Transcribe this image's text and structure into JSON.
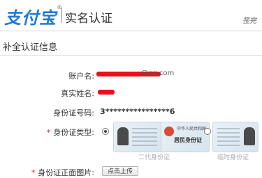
{
  "header": {
    "logo_text": "支付宝",
    "logo_reg": "®",
    "page_title": "实名认证",
    "exit_link": "签完"
  },
  "section": {
    "title": "补全认证信息"
  },
  "form": {
    "account_label": "账户名:",
    "account_value_suffix": "@qq.com",
    "realname_label": "真实姓名:",
    "id_number_label": "身份证号码:",
    "id_number_value": "3****************6",
    "id_type_label": "身份证类型:",
    "id_type_required": "*",
    "id_type_options": [
      {
        "caption": "二代身份证",
        "selected": true
      },
      {
        "caption": "临时身份证",
        "selected": false
      }
    ],
    "id_card_back_text": "中华人民共和国",
    "id_card_back_title": "居民身份证",
    "front_photo_label": "身份证正面图片:",
    "front_photo_required": "*",
    "upload_button": "点击上传"
  },
  "colors": {
    "brand": "#1f7ad6",
    "required": "#e02020",
    "redaction": "#e8101a"
  }
}
